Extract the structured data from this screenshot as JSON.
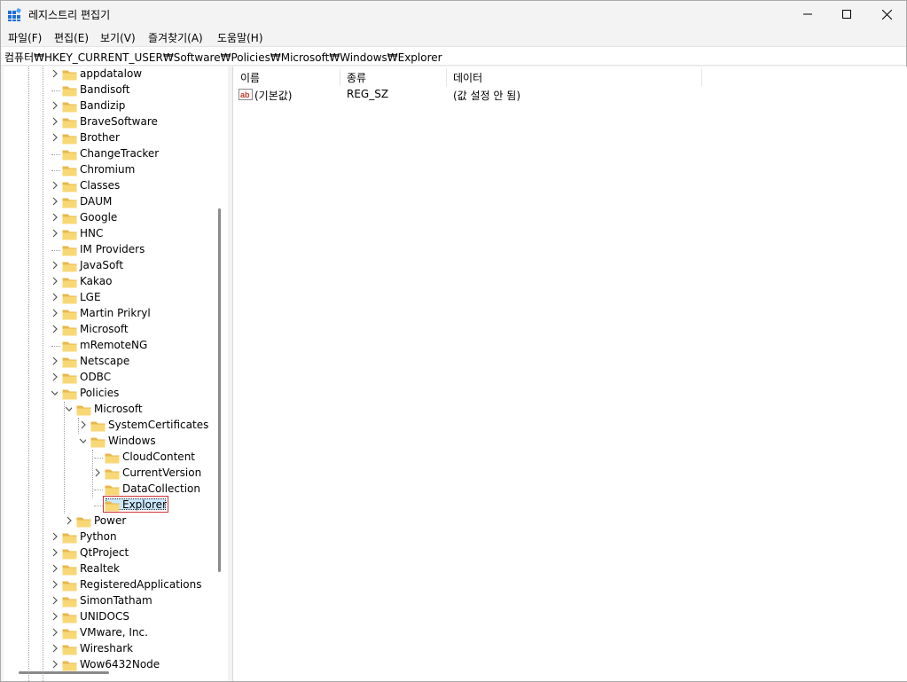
{
  "window": {
    "title": "레지스트리 편집기"
  },
  "menu": [
    "파일(F)",
    "편집(E)",
    "보기(V)",
    "즐겨찾기(A)",
    "도움말(H)"
  ],
  "address": "컴퓨터₩HKEY_CURRENT_USER₩Software₩Policies₩Microsoft₩Windows₩Explorer",
  "tree": [
    {
      "label": "appdatalow",
      "level": 0,
      "expander": "collapsed"
    },
    {
      "label": "Bandisoft",
      "level": 0,
      "expander": "none"
    },
    {
      "label": "Bandizip",
      "level": 0,
      "expander": "collapsed"
    },
    {
      "label": "BraveSoftware",
      "level": 0,
      "expander": "collapsed"
    },
    {
      "label": "Brother",
      "level": 0,
      "expander": "collapsed"
    },
    {
      "label": "ChangeTracker",
      "level": 0,
      "expander": "none"
    },
    {
      "label": "Chromium",
      "level": 0,
      "expander": "none"
    },
    {
      "label": "Classes",
      "level": 0,
      "expander": "collapsed"
    },
    {
      "label": "DAUM",
      "level": 0,
      "expander": "collapsed"
    },
    {
      "label": "Google",
      "level": 0,
      "expander": "collapsed"
    },
    {
      "label": "HNC",
      "level": 0,
      "expander": "collapsed"
    },
    {
      "label": "IM Providers",
      "level": 0,
      "expander": "none"
    },
    {
      "label": "JavaSoft",
      "level": 0,
      "expander": "collapsed"
    },
    {
      "label": "Kakao",
      "level": 0,
      "expander": "collapsed"
    },
    {
      "label": "LGE",
      "level": 0,
      "expander": "collapsed"
    },
    {
      "label": "Martin Prikryl",
      "level": 0,
      "expander": "collapsed"
    },
    {
      "label": "Microsoft",
      "level": 0,
      "expander": "collapsed"
    },
    {
      "label": "mRemoteNG",
      "level": 0,
      "expander": "none"
    },
    {
      "label": "Netscape",
      "level": 0,
      "expander": "collapsed"
    },
    {
      "label": "ODBC",
      "level": 0,
      "expander": "collapsed"
    },
    {
      "label": "Policies",
      "level": 0,
      "expander": "expanded"
    },
    {
      "label": "Microsoft",
      "level": 1,
      "expander": "expanded"
    },
    {
      "label": "SystemCertificates",
      "level": 2,
      "expander": "collapsed"
    },
    {
      "label": "Windows",
      "level": 2,
      "expander": "expanded"
    },
    {
      "label": "CloudContent",
      "level": 3,
      "expander": "none"
    },
    {
      "label": "CurrentVersion",
      "level": 3,
      "expander": "collapsed"
    },
    {
      "label": "DataCollection",
      "level": 3,
      "expander": "none"
    },
    {
      "label": "Explorer",
      "level": 3,
      "expander": "none",
      "selected": true
    },
    {
      "label": "Power",
      "level": 1,
      "expander": "collapsed"
    },
    {
      "label": "Python",
      "level": 0,
      "expander": "collapsed"
    },
    {
      "label": "QtProject",
      "level": 0,
      "expander": "collapsed"
    },
    {
      "label": "Realtek",
      "level": 0,
      "expander": "collapsed"
    },
    {
      "label": "RegisteredApplications",
      "level": 0,
      "expander": "collapsed"
    },
    {
      "label": "SimonTatham",
      "level": 0,
      "expander": "collapsed"
    },
    {
      "label": "UNIDOCS",
      "level": 0,
      "expander": "collapsed"
    },
    {
      "label": "VMware, Inc.",
      "level": 0,
      "expander": "collapsed"
    },
    {
      "label": "Wireshark",
      "level": 0,
      "expander": "collapsed"
    },
    {
      "label": "Wow6432Node",
      "level": 0,
      "expander": "collapsed"
    }
  ],
  "columns": [
    "이름",
    "종류",
    "데이터"
  ],
  "values": [
    {
      "name": "(기본값)",
      "type": "REG_SZ",
      "data": "(값 설정 안 됨)",
      "icon": "string-value-icon"
    }
  ],
  "colors": {
    "folder": "#f8d775",
    "folder_dark": "#e8b84a",
    "selection": "#cce8ff",
    "selection_border": "#d13438"
  }
}
